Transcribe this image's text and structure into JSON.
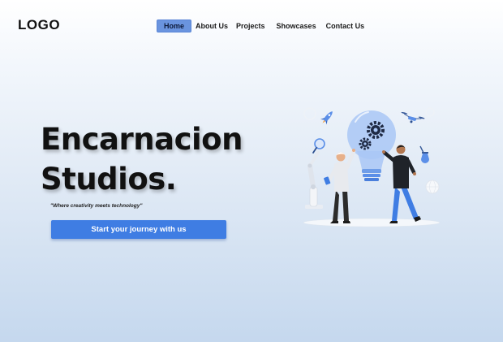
{
  "header": {
    "logo": "LOGO",
    "nav": [
      {
        "label": "Home",
        "active": true
      },
      {
        "label": "About Us",
        "active": false
      },
      {
        "label": "Projects",
        "active": false
      },
      {
        "label": "Showcases",
        "active": false
      },
      {
        "label": "Contact Us",
        "active": false
      }
    ]
  },
  "hero": {
    "title_line1": "Encarnacion",
    "title_line2": "Studios.",
    "tagline": "\"Where creativity meets technology\"",
    "cta_label": "Start your journey with us"
  },
  "colors": {
    "accent": "#3f7de3",
    "nav_active": "#6a94df",
    "background_bottom": "#c5d8ee"
  },
  "illustration": {
    "icons": [
      "rocket-icon",
      "drone-icon",
      "magnifier-icon",
      "lightbulb-icon",
      "gears-icon",
      "robot-arm-icon",
      "flask-icon",
      "globe-icon"
    ]
  }
}
